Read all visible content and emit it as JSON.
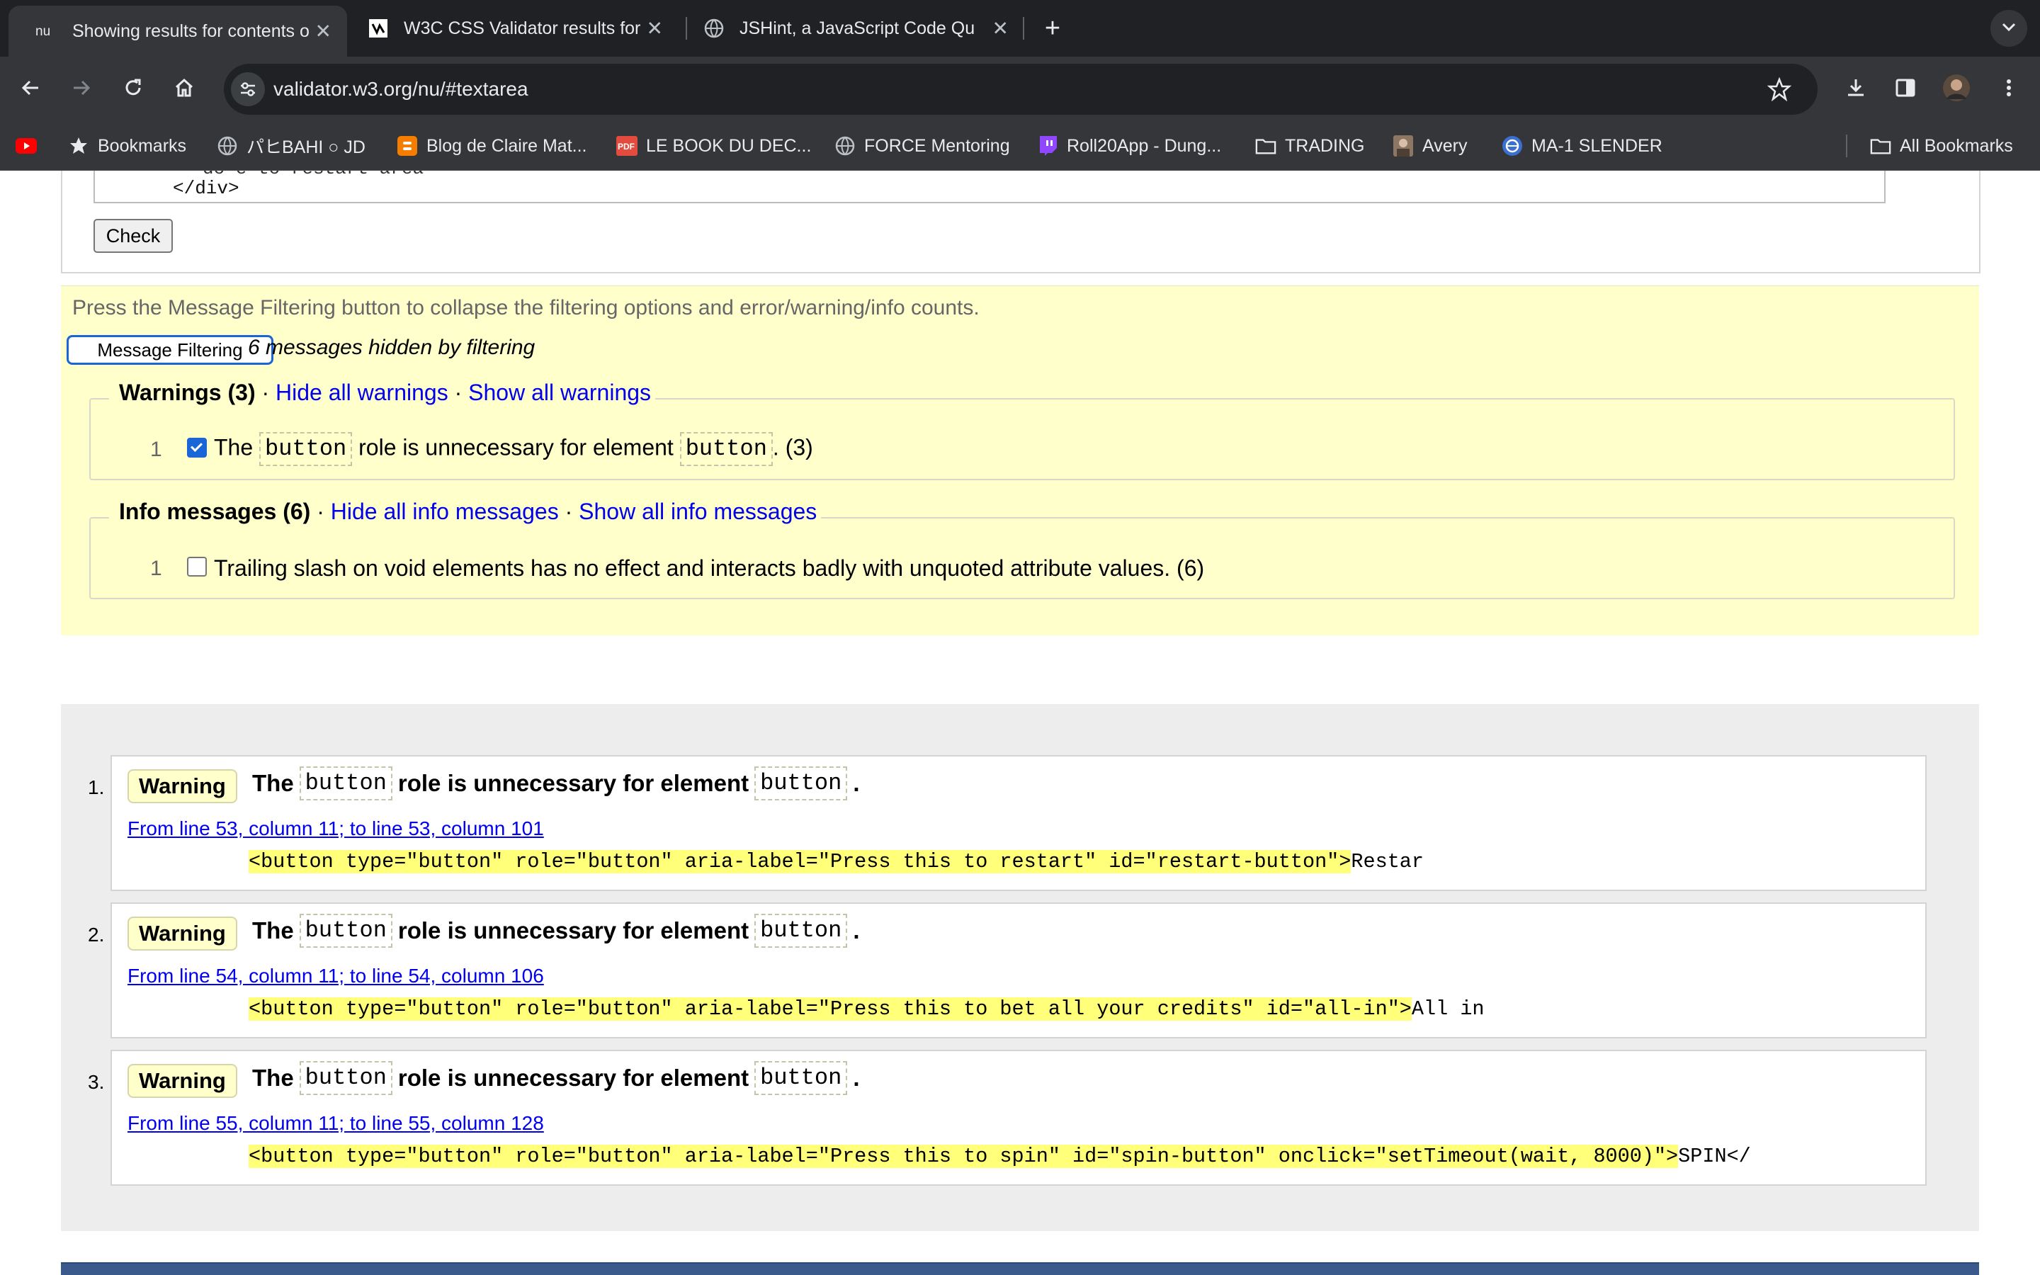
{
  "browser": {
    "tabs": [
      {
        "title": "Showing results for contents o",
        "favicon": "nu-logo",
        "active": true
      },
      {
        "title": "W3C CSS Validator results for",
        "favicon": "w3c-logo",
        "active": false
      },
      {
        "title": "JSHint, a JavaScript Code Qu",
        "favicon": "globe-icon",
        "active": false
      }
    ],
    "url": "validator.w3.org/nu/#textarea",
    "bookmarks": [
      {
        "label": "",
        "icon": "youtube-icon"
      },
      {
        "label": "Bookmarks",
        "icon": "star-icon"
      },
      {
        "label": "パヒBAHI ○ JD",
        "icon": "globe-icon"
      },
      {
        "label": "Blog de Claire Mat...",
        "icon": "blogger-icon"
      },
      {
        "label": "LE BOOK DU DEC...",
        "icon": "pdf-icon"
      },
      {
        "label": "FORCE Mentoring",
        "icon": "globe-icon"
      },
      {
        "label": "Roll20App - Dung...",
        "icon": "twitch-icon"
      },
      {
        "label": "TRADING",
        "icon": "folder-icon"
      },
      {
        "label": "Avery",
        "icon": "image-icon"
      },
      {
        "label": "MA-1 SLENDER",
        "icon": "brand-icon"
      }
    ],
    "all_bookmarks": "All Bookmarks"
  },
  "form": {
    "textarea_line1": "do e to  restart  area",
    "textarea_line2": "</div>",
    "check_label": "Check"
  },
  "filter": {
    "instructions": "Press the Message Filtering button to collapse the filtering options and error/warning/info counts.",
    "button_label": "Message Filtering",
    "hidden_count": "6 messages hidden by filtering",
    "warnings": {
      "title": "Warnings (3)",
      "dot": "·",
      "hide_link": "Hide all warnings",
      "show_link": "Show all warnings",
      "row": {
        "num": "1",
        "checked": true,
        "pre": "The",
        "code1": "button",
        "mid": "role is unnecessary for element",
        "code2": "button",
        "post": ". (3)"
      }
    },
    "info": {
      "title": "Info messages (6)",
      "dot": "·",
      "hide_link": "Hide all info messages",
      "show_link": "Show all info messages",
      "row": {
        "num": "1",
        "checked": false,
        "text": "Trailing slash on void elements has no effect and interacts badly with unquoted attribute values. (6)"
      }
    }
  },
  "results": {
    "messages": [
      {
        "index": "1.",
        "badge": "Warning",
        "pre": "The",
        "code1": "button",
        "mid": "role is unnecessary for element",
        "code2": "button",
        "post": ".",
        "location": "From line 53, column 11; to line 53, column 101",
        "extract_pad": "          ",
        "extract_hl": "<button type=\"button\" role=\"button\" aria-label=\"Press this to restart\" id=\"restart-button\">",
        "extract_tail": "Restar"
      },
      {
        "index": "2.",
        "badge": "Warning",
        "pre": "The",
        "code1": "button",
        "mid": "role is unnecessary for element",
        "code2": "button",
        "post": ".",
        "location": "From line 54, column 11; to line 54, column 106",
        "extract_pad": "          ",
        "extract_hl": "<button type=\"button\" role=\"button\" aria-label=\"Press this to bet all your credits\" id=\"all-in\">",
        "extract_tail": "All in"
      },
      {
        "index": "3.",
        "badge": "Warning",
        "pre": "The",
        "code1": "button",
        "mid": "role is unnecessary for element",
        "code2": "button",
        "post": ".",
        "location": "From line 55, column 11; to line 55, column 128",
        "extract_pad": "          ",
        "extract_hl": "<button type=\"button\" role=\"button\" aria-label=\"Press this to spin\" id=\"spin-button\" onclick=\"setTimeout(wait, 8000)\">",
        "extract_tail": "SPIN</"
      }
    ]
  },
  "colors": {
    "filter_panel_bg": "#ffffcc",
    "link": "#0000ee",
    "extract_highlight": "#ffff7a",
    "chrome_dark": "#202124",
    "chrome_toolbar": "#35363a"
  }
}
